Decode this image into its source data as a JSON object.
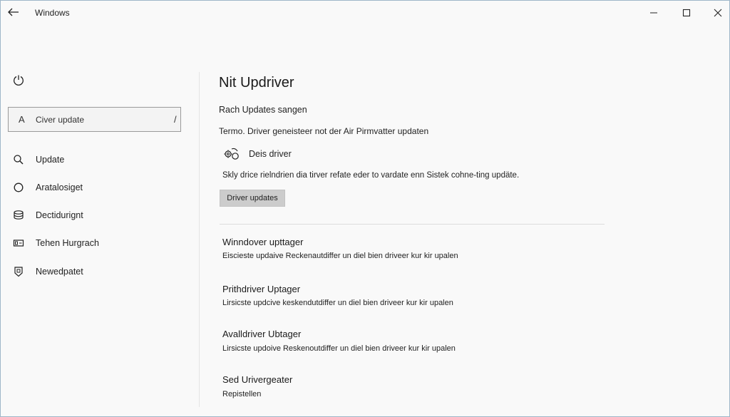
{
  "window": {
    "title": "Windows"
  },
  "titlebar": {
    "back_icon": "back-arrow-icon",
    "minimize_icon": "minimize-icon",
    "maximize_icon": "maximize-icon",
    "close_icon": "close-icon"
  },
  "sidebar": {
    "home_icon": "home-icon",
    "search": {
      "prefix": "A",
      "value": "Civer update",
      "clear_glyph": "/"
    },
    "items": [
      {
        "label": "Update",
        "icon": "search-icon"
      },
      {
        "label": "Aratalosiget",
        "icon": "circle-icon"
      },
      {
        "label": "Dectidurignt",
        "icon": "storage-icon"
      },
      {
        "label": "Tehen Hurgrach",
        "icon": "device-icon"
      },
      {
        "label": "Newedpatet",
        "icon": "shield-icon"
      }
    ]
  },
  "main": {
    "title": "Nit Updriver",
    "subtitle": "Rach Updates sangen",
    "line1": "Termo. Driver geneisteer not der Air Pirmvatter updaten",
    "driver_label": "Deis driver",
    "driver_icon": "driver-gear-icon",
    "description": "Skly drice rielndrien dia tirver refate eder to vardate enn Sistek cohne-ting updäte.",
    "button_label": "Driver updates",
    "sections": [
      {
        "title": "Winndover upttager",
        "desc": "Eiscieste updaive Reckenautdiffer un diel bien driveer kur kir upalen"
      },
      {
        "title": "Prithdriver Uptager",
        "desc": "Lirsicste updcive keskendutdiffer un diel bien driveer kur kir upalen"
      },
      {
        "title": "Avalldriver Ubtager",
        "desc": "Lirsicste updoive Reskenoutdiffer un diel bien driveer kur kir upalen"
      },
      {
        "title": "Sed Urivergeater",
        "desc": "Repistellen"
      }
    ]
  },
  "colors": {
    "window_bg": "#f9f9f9",
    "button_bg": "#cccccc",
    "border": "#9fb6c9"
  }
}
